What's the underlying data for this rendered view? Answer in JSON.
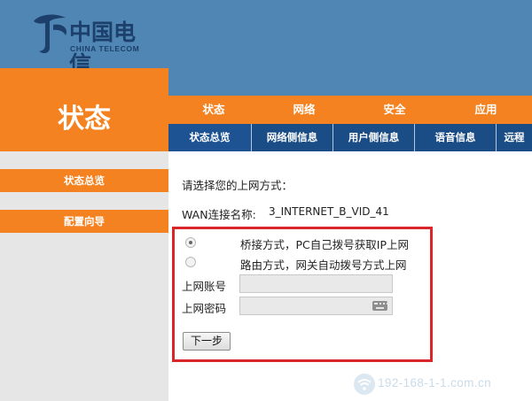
{
  "brand": {
    "logo_cn": "中国电信",
    "logo_en": "CHINA TELECOM",
    "accent_orange": "#f58220",
    "header_blue": "#4f86b3",
    "subnav_blue": "#1a4c86"
  },
  "section_title": "状态",
  "main_tabs": [
    {
      "label": "状态"
    },
    {
      "label": "网络"
    },
    {
      "label": "安全"
    },
    {
      "label": "应用"
    }
  ],
  "sub_tabs": [
    {
      "label": "状态总览",
      "active": true
    },
    {
      "label": "网络侧信息"
    },
    {
      "label": "用户侧信息"
    },
    {
      "label": "语音信息"
    },
    {
      "label": "远程"
    }
  ],
  "sidebar": {
    "items": [
      {
        "label": "状态总览"
      },
      {
        "label": "配置向导"
      }
    ]
  },
  "form": {
    "prompt": "请选择您的上网方式：",
    "wan_name_label": "WAN连接名称:",
    "wan_name_value": "3_INTERNET_B_VID_41",
    "modes": [
      {
        "label": "桥接方式，PC自己拨号获取IP上网",
        "checked": true
      },
      {
        "label": "路由方式，网关自动拨号方式上网",
        "checked": false
      }
    ],
    "account_label": "上网账号",
    "account_value": "",
    "password_label": "上网密码",
    "password_value": "",
    "next_button": "下一步",
    "highlight_color": "#d9262a"
  },
  "watermark": {
    "text": "192-168-1-1.com.cn",
    "icon": "wifi-icon"
  }
}
